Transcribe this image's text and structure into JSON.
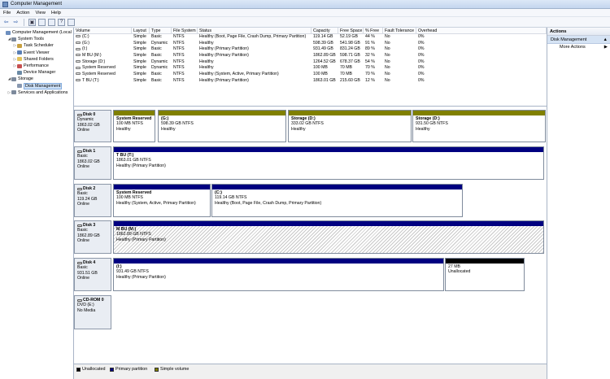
{
  "window": {
    "title": "Computer Management"
  },
  "menu": [
    "File",
    "Action",
    "View",
    "Help"
  ],
  "toolbar": {
    "back": "⇦",
    "forward": "⇨",
    "up": "▣",
    "help": "?"
  },
  "tree": [
    {
      "label": "Computer Management (Local",
      "depth": 0,
      "exp": "",
      "icon": "#6d8fbf"
    },
    {
      "label": "System Tools",
      "depth": 1,
      "exp": "◢",
      "icon": "#7d8a9c"
    },
    {
      "label": "Task Scheduler",
      "depth": 2,
      "exp": "▷",
      "icon": "#c8a040"
    },
    {
      "label": "Event Viewer",
      "depth": 2,
      "exp": "▷",
      "icon": "#5a7fb5"
    },
    {
      "label": "Shared Folders",
      "depth": 2,
      "exp": "▷",
      "icon": "#e2c25a"
    },
    {
      "label": "Performance",
      "depth": 2,
      "exp": "▷",
      "icon": "#c65050"
    },
    {
      "label": "Device Manager",
      "depth": 2,
      "exp": "",
      "icon": "#6b8aa5"
    },
    {
      "label": "Storage",
      "depth": 1,
      "exp": "◢",
      "icon": "#7d8a9c"
    },
    {
      "label": "Disk Management",
      "depth": 2,
      "exp": "",
      "icon": "#8898b0",
      "selected": true
    },
    {
      "label": "Services and Applications",
      "depth": 1,
      "exp": "▷",
      "icon": "#7d8a9c"
    }
  ],
  "volumes": {
    "headers": [
      "Volume",
      "Layout",
      "Type",
      "File System",
      "Status",
      "Capacity",
      "Free Space",
      "% Free",
      "Fault Tolerance",
      "Overhead"
    ],
    "rows": [
      [
        "(C:)",
        "Simple",
        "Basic",
        "NTFS",
        "Healthy (Boot, Page File, Crash Dump, Primary Partition)",
        "119.14 GB",
        "52.19 GB",
        "44 %",
        "No",
        "0%"
      ],
      [
        "(G:)",
        "Simple",
        "Dynamic",
        "NTFS",
        "Healthy",
        "598.39 GB",
        "541.98 GB",
        "91 %",
        "No",
        "0%"
      ],
      [
        "(I:)",
        "Simple",
        "Basic",
        "NTFS",
        "Healthy (Primary Partition)",
        "931.49 GB",
        "831.24 GB",
        "89 %",
        "No",
        "0%"
      ],
      [
        "M BU (M:)",
        "Simple",
        "Basic",
        "NTFS",
        "Healthy (Primary Partition)",
        "1862.89 GB",
        "598.71 GB",
        "32 %",
        "No",
        "0%"
      ],
      [
        "Storage (D:)",
        "Simple",
        "Dynamic",
        "NTFS",
        "Healthy",
        "1264.52 GB",
        "678.37 GB",
        "54 %",
        "No",
        "0%"
      ],
      [
        "System Reserved",
        "Simple",
        "Dynamic",
        "NTFS",
        "Healthy",
        "100 MB",
        "70 MB",
        "70 %",
        "No",
        "0%"
      ],
      [
        "System Reserved",
        "Simple",
        "Basic",
        "NTFS",
        "Healthy (System, Active, Primary Partition)",
        "100 MB",
        "70 MB",
        "70 %",
        "No",
        "0%"
      ],
      [
        "T BU (T:)",
        "Simple",
        "Basic",
        "NTFS",
        "Healthy (Primary Partition)",
        "1863.01 GB",
        "215.60 GB",
        "12 %",
        "No",
        "0%"
      ]
    ]
  },
  "disks": [
    {
      "lines": [
        "Disk 0",
        "Dynamic",
        "1863.02 GB",
        "Online"
      ],
      "partitions": [
        {
          "name": "System Reserved",
          "size": "100 MB NTFS",
          "status": "Healthy",
          "color": "#808000"
        },
        {
          "name": "(G:)",
          "size": "598.39 GB NTFS",
          "status": "Healthy",
          "color": "#808000"
        },
        {
          "name": "Storage  (D:)",
          "size": "333.02 GB NTFS",
          "status": "Healthy",
          "color": "#808000"
        },
        {
          "name": "Storage  (D:)",
          "size": "931.50 GB NTFS",
          "status": "Healthy",
          "color": "#808000"
        }
      ]
    },
    {
      "lines": [
        "Disk 1",
        "Basic",
        "1863.02 GB",
        "Online"
      ],
      "partitions": [
        {
          "name": "T BU  (T:)",
          "size": "1863.01 GB NTFS",
          "status": "Healthy (Primary Partition)",
          "color": "#000080"
        }
      ]
    },
    {
      "lines": [
        "Disk 2",
        "Basic",
        "119.24 GB",
        "Online"
      ],
      "partitions": [
        {
          "name": "System Reserved",
          "size": "100 MB NTFS",
          "status": "Healthy (System, Active, Primary Partition)",
          "color": "#000080"
        },
        {
          "name": "(C:)",
          "size": "119.14 GB NTFS",
          "status": "Healthy (Boot, Page File, Crash Dump, Primary Partition)",
          "color": "#000080"
        }
      ]
    },
    {
      "lines": [
        "Disk 3",
        "Basic",
        "1862.89 GB",
        "Online"
      ],
      "partitions": [
        {
          "name": "M BU  (M:)",
          "size": "1862.89 GB NTFS",
          "status": "Healthy (Primary Partition)",
          "color": "#000080",
          "hatched": true
        }
      ]
    },
    {
      "lines": [
        "Disk 4",
        "Basic",
        "931.51 GB",
        "Online"
      ],
      "partitions": [
        {
          "name": "(I:)",
          "size": "931.49 GB NTFS",
          "status": "Healthy (Primary Partition)",
          "color": "#000080"
        },
        {
          "name": "",
          "size": "27 MB",
          "status": "Unallocated",
          "color": "#000000"
        }
      ]
    },
    {
      "lines": [
        "CD-ROM 0",
        "DVD (E:)",
        "",
        "No Media"
      ],
      "partitions": []
    }
  ],
  "legend": [
    {
      "label": "Unallocated",
      "color": "#000000"
    },
    {
      "label": "Primary partition",
      "color": "#000080"
    },
    {
      "label": "Simple volume",
      "color": "#808000"
    }
  ],
  "actions": {
    "header": "Actions",
    "section": "Disk Management",
    "section_arrow": "▲",
    "item": "More Actions",
    "item_arrow": "▶"
  }
}
